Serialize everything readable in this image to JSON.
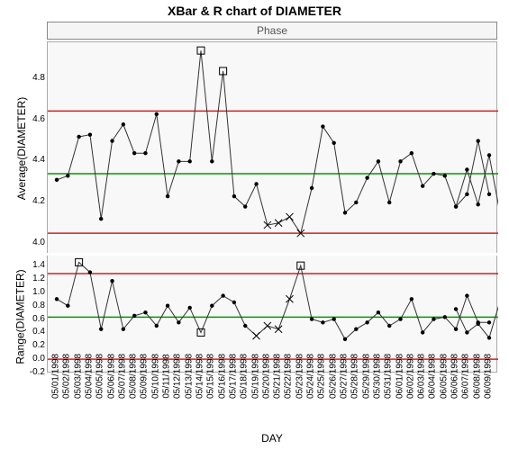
{
  "title": "XBar & R chart of DIAMETER",
  "phase_label": "Phase",
  "x_axis_label": "DAY",
  "y_axis_label_top": "Average(DIAMETER)",
  "y_axis_label_bottom": "Range(DIAMETER)",
  "chart_data": [
    {
      "type": "line",
      "title": "Average(DIAMETER)",
      "ylim": [
        3.95,
        4.98
      ],
      "y_ticks": [
        4.0,
        4.2,
        4.4,
        4.6,
        4.8
      ],
      "center": 4.34,
      "ucl": 4.645,
      "lcl": 4.05,
      "categories": [
        "05/01/1998",
        "05/02/1998",
        "05/03/1998",
        "05/04/1998",
        "05/05/1998",
        "05/06/1998",
        "05/07/1998",
        "05/08/1998",
        "05/09/1998",
        "05/10/1998",
        "05/11/1998",
        "05/12/1998",
        "05/13/1998",
        "05/14/1998",
        "05/15/1998",
        "05/16/1998",
        "05/17/1998",
        "05/18/1998",
        "05/19/1998",
        "05/20/1998",
        "05/21/1998",
        "05/22/1998",
        "05/23/1998",
        "05/24/1998",
        "05/25/1998",
        "05/26/1998",
        "05/27/1998",
        "05/28/1998",
        "05/29/1998",
        "05/30/1998",
        "05/31/1998",
        "06/01/1998",
        "06/02/1998",
        "06/03/1998",
        "06/04/1998",
        "06/05/1998",
        "06/06/1998",
        "06/07/1998",
        "06/08/1998",
        "06/09/1998"
      ],
      "values": [
        4.31,
        4.33,
        4.52,
        4.53,
        4.12,
        4.5,
        4.58,
        4.44,
        4.44,
        4.63,
        4.23,
        4.4,
        4.4,
        4.94,
        4.4,
        4.84,
        4.23,
        4.18,
        4.29,
        4.09,
        4.1,
        4.13,
        4.05,
        4.27,
        4.57,
        4.49,
        4.15,
        4.2,
        4.32,
        4.4,
        4.2,
        4.4,
        4.44,
        4.28,
        4.34,
        4.33,
        4.18,
        4.24,
        4.5,
        4.24
      ],
      "flags": [
        "n",
        "n",
        "n",
        "n",
        "n",
        "n",
        "n",
        "n",
        "n",
        "n",
        "n",
        "n",
        "n",
        "sq",
        "n",
        "sq",
        "n",
        "n",
        "n",
        "x",
        "x",
        "x",
        "x",
        "n",
        "n",
        "n",
        "n",
        "n",
        "n",
        "n",
        "n",
        "n",
        "n",
        "n",
        "n",
        "n",
        "n",
        "n",
        "n",
        "n"
      ],
      "second_segment_start": 36,
      "second_segment_values": [
        4.18,
        4.36,
        4.19,
        4.43,
        4.14
      ]
    },
    {
      "type": "line",
      "title": "Range(DIAMETER)",
      "ylim": [
        -0.2,
        1.55
      ],
      "y_ticks": [
        -0.2,
        0.0,
        0.2,
        0.4,
        0.6,
        0.8,
        1.0,
        1.2,
        1.4
      ],
      "center": 0.63,
      "ucl": 1.28,
      "lcl": 0.0,
      "values": [
        0.9,
        0.8,
        1.45,
        1.3,
        0.45,
        1.17,
        0.45,
        0.65,
        0.7,
        0.5,
        0.8,
        0.55,
        0.77,
        0.4,
        0.8,
        0.95,
        0.85,
        0.5,
        0.35,
        0.5,
        0.45,
        0.9,
        1.4,
        0.6,
        0.55,
        0.6,
        0.3,
        0.45,
        0.55,
        0.7,
        0.5,
        0.6,
        0.9,
        0.4,
        0.6,
        0.63,
        0.45,
        0.95,
        0.55,
        0.55
      ],
      "flags": [
        "n",
        "n",
        "sq",
        "n",
        "n",
        "n",
        "n",
        "n",
        "n",
        "n",
        "n",
        "n",
        "n",
        "sq",
        "n",
        "n",
        "n",
        "n",
        "x",
        "x",
        "x",
        "x",
        "sq",
        "n",
        "n",
        "n",
        "n",
        "n",
        "n",
        "n",
        "n",
        "n",
        "n",
        "n",
        "n",
        "n",
        "n",
        "n",
        "n",
        "n"
      ],
      "second_segment_start": 36,
      "second_segment_values": [
        0.75,
        0.4,
        0.53,
        0.32,
        0.88
      ]
    }
  ]
}
